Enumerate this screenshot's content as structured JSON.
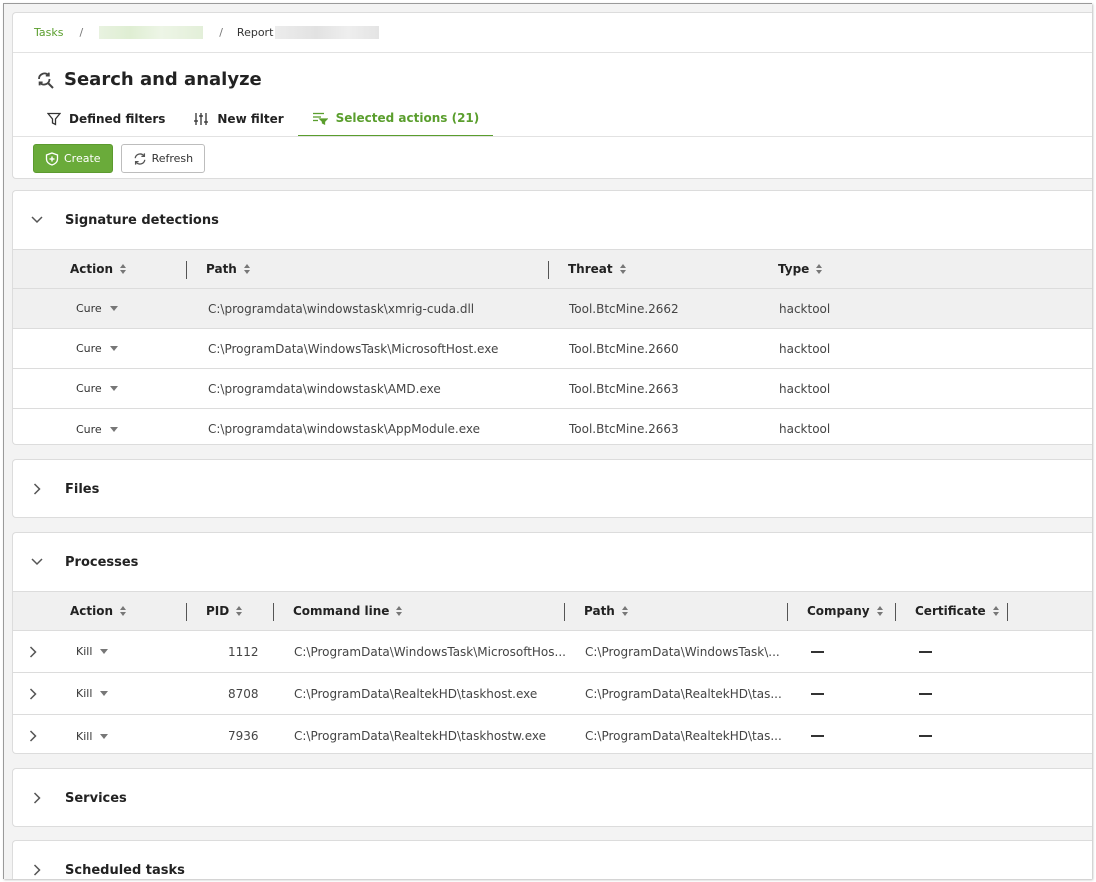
{
  "breadcrumb": {
    "tasks": "Tasks",
    "separator": "/",
    "report": "Report"
  },
  "page": {
    "title": "Search and analyze"
  },
  "tabs": [
    {
      "label": "Defined filters",
      "icon": "funnel-icon"
    },
    {
      "label": "New filter",
      "icon": "sliders-icon"
    },
    {
      "label": "Selected actions (21)",
      "icon": "filter-list-icon"
    }
  ],
  "toolbar": {
    "create_label": "Create",
    "refresh_label": "Refresh"
  },
  "colors": {
    "accent": "#5a9e2d",
    "primary_button": "#6aab3a"
  },
  "signature_detections": {
    "title": "Signature detections",
    "columns": {
      "action": "Action",
      "path": "Path",
      "threat": "Threat",
      "type": "Type"
    },
    "rows": [
      {
        "action": "Cure",
        "path": "C:\\programdata\\windowstask\\xmrig-cuda.dll",
        "threat": "Tool.BtcMine.2662",
        "type": "hacktool"
      },
      {
        "action": "Cure",
        "path": "C:\\ProgramData\\WindowsTask\\MicrosoftHost.exe",
        "threat": "Tool.BtcMine.2660",
        "type": "hacktool"
      },
      {
        "action": "Cure",
        "path": "C:\\programdata\\windowstask\\AMD.exe",
        "threat": "Tool.BtcMine.2663",
        "type": "hacktool"
      },
      {
        "action": "Cure",
        "path": "C:\\programdata\\windowstask\\AppModule.exe",
        "threat": "Tool.BtcMine.2663",
        "type": "hacktool"
      }
    ]
  },
  "files": {
    "title": "Files"
  },
  "processes": {
    "title": "Processes",
    "columns": {
      "action": "Action",
      "pid": "PID",
      "command_line": "Command line",
      "path": "Path",
      "company": "Company",
      "certificate": "Certificate"
    },
    "rows": [
      {
        "action": "Kill",
        "pid": "1112",
        "command_line": "C:\\ProgramData\\WindowsTask\\MicrosoftHos...",
        "path": "C:\\ProgramData\\WindowsTask\\..."
      },
      {
        "action": "Kill",
        "pid": "8708",
        "command_line": "C:\\ProgramData\\RealtekHD\\taskhost.exe",
        "path": "C:\\ProgramData\\RealtekHD\\tas..."
      },
      {
        "action": "Kill",
        "pid": "7936",
        "command_line": "C:\\ProgramData\\RealtekHD\\taskhostw.exe",
        "path": "C:\\ProgramData\\RealtekHD\\tas..."
      }
    ]
  },
  "services": {
    "title": "Services"
  },
  "scheduled_tasks": {
    "title": "Scheduled tasks"
  }
}
